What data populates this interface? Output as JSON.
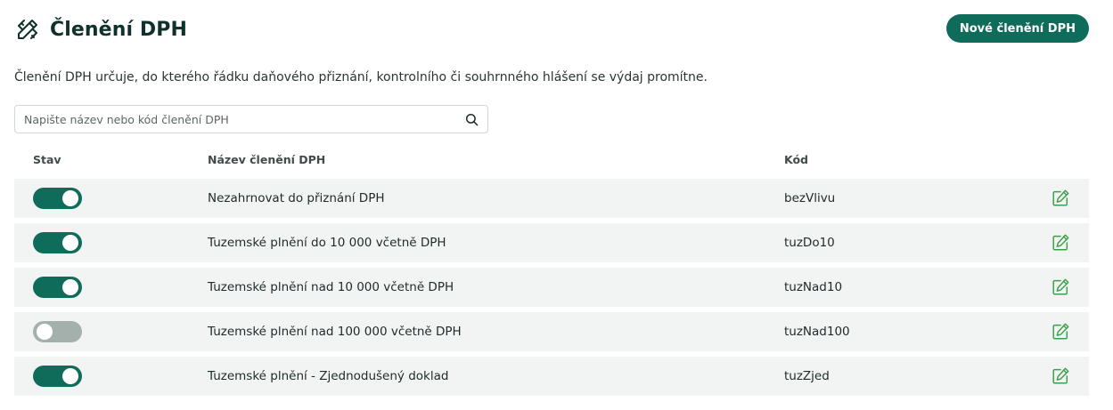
{
  "header": {
    "title": "Členění DPH",
    "icon": "pencil-ruler-icon",
    "new_button_label": "Nové členění DPH"
  },
  "description": "Členění DPH určuje, do kterého řádku daňového přiznání, kontrolního či souhrnného hlášení se výdaj promítne.",
  "search": {
    "placeholder": "Napište název nebo kód členění DPH",
    "value": "",
    "icon": "search-icon"
  },
  "table": {
    "columns": [
      "Stav",
      "Název členění DPH",
      "Kód"
    ],
    "rows": [
      {
        "active": true,
        "name": "Nezahrnovat do přiznání DPH",
        "code": "bezVlivu"
      },
      {
        "active": true,
        "name": "Tuzemské plnění do 10 000 včetně DPH",
        "code": "tuzDo10"
      },
      {
        "active": true,
        "name": "Tuzemské plnění nad 10 000 včetně DPH",
        "code": "tuzNad10"
      },
      {
        "active": false,
        "name": "Tuzemské plnění nad 100 000 včetně DPH",
        "code": "tuzNad100"
      },
      {
        "active": true,
        "name": "Tuzemské plnění - Zjednodušený doklad",
        "code": "tuzZjed"
      }
    ],
    "edit_icon": "edit-icon"
  },
  "colors": {
    "accent": "#0f6b5a",
    "toggle_off": "#a3b0ac",
    "edit_icon": "#3aa04a",
    "row_background": "#f2f4f3"
  }
}
